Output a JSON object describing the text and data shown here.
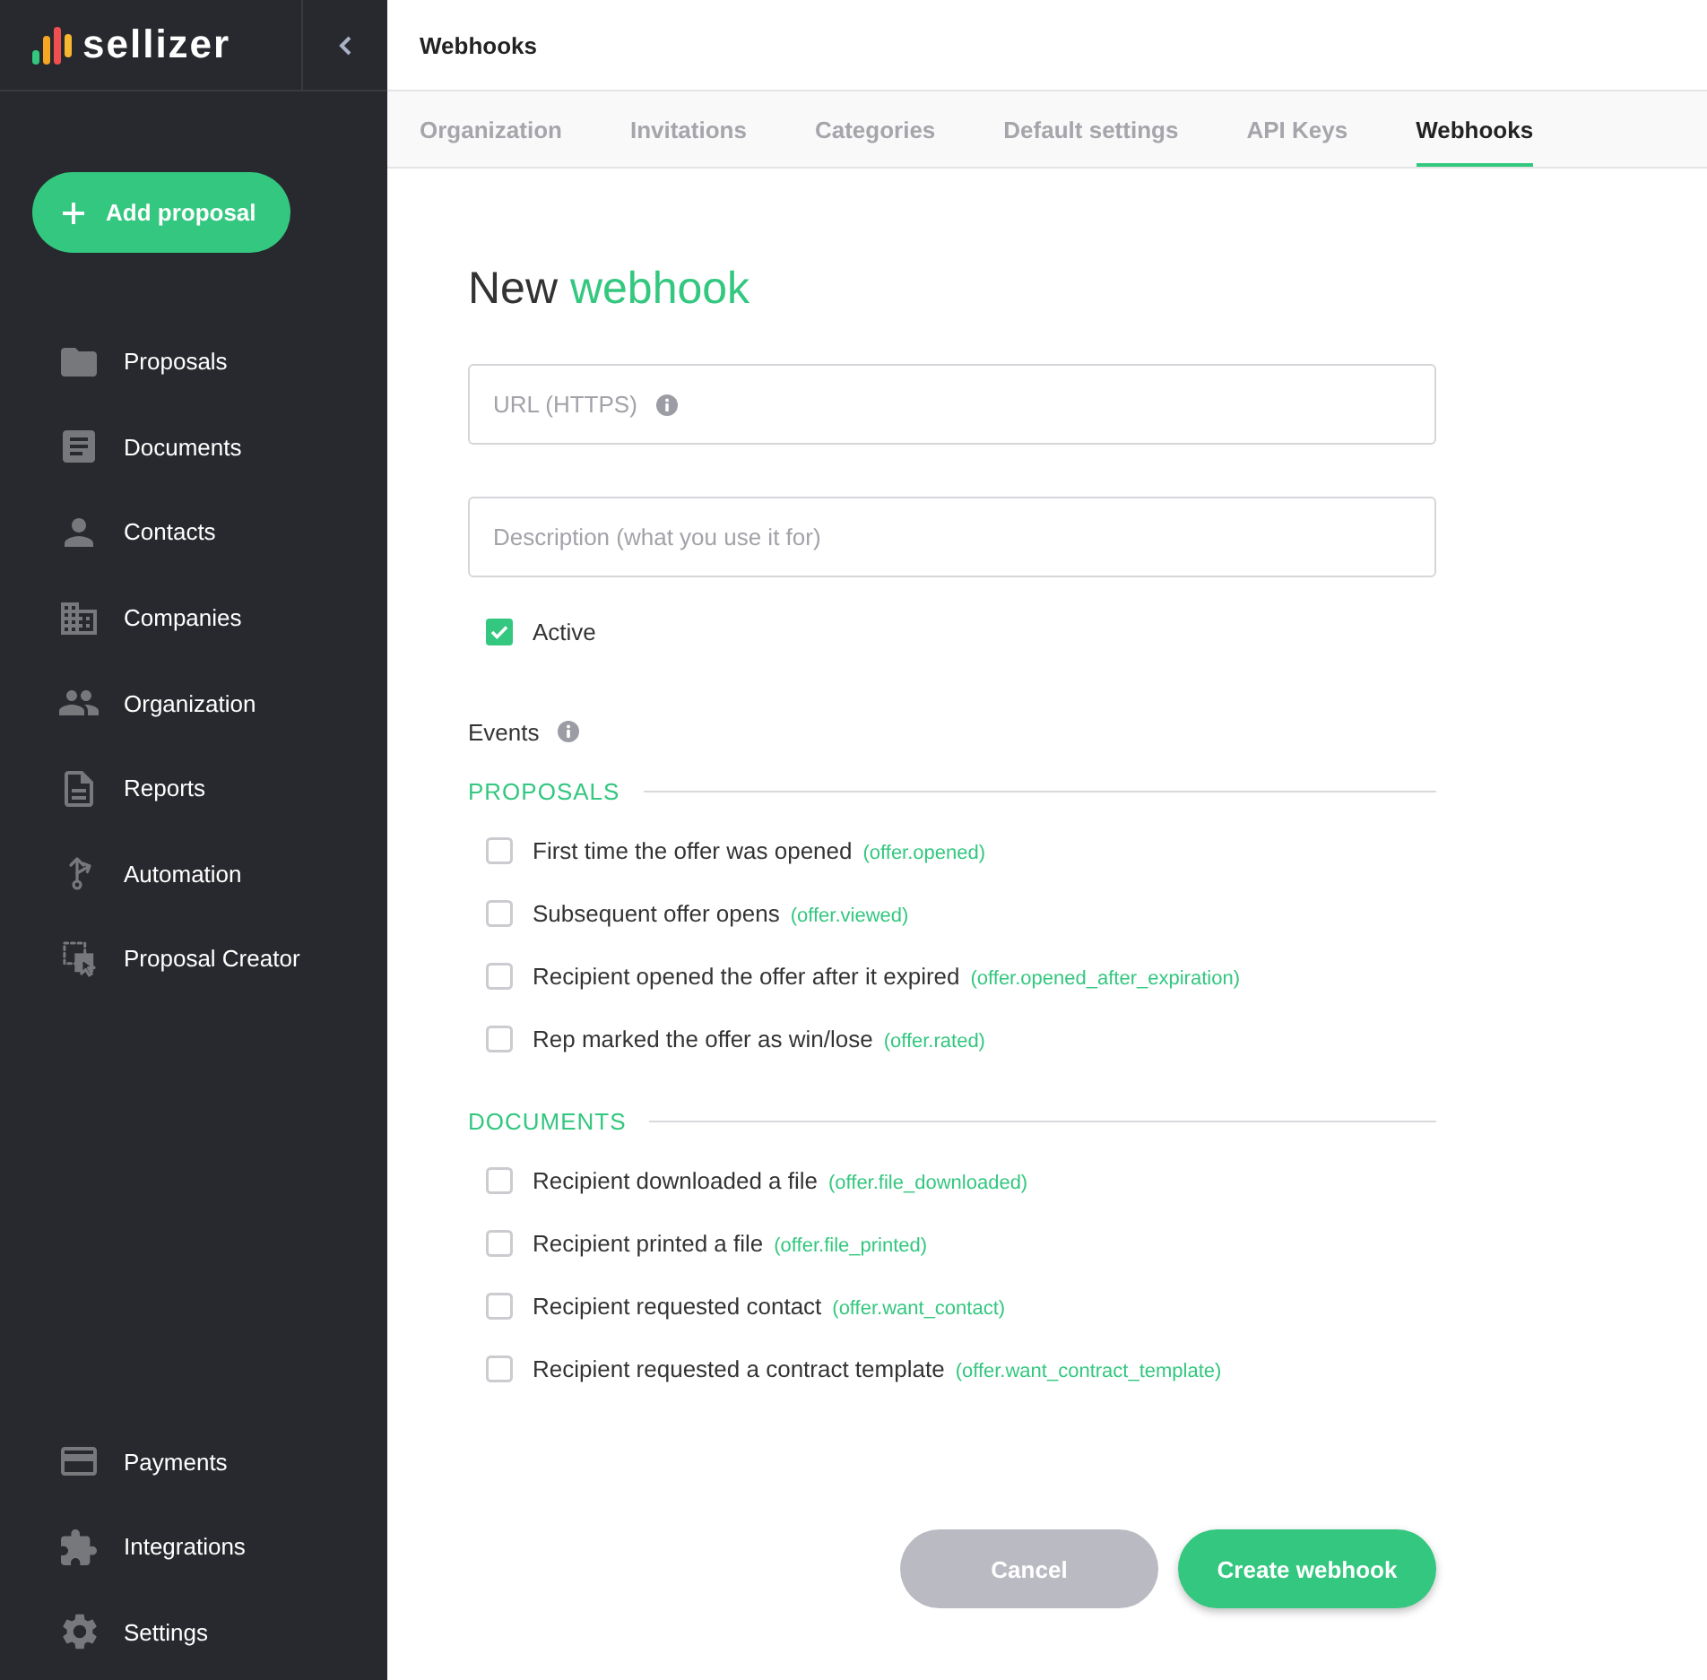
{
  "sidebar": {
    "brand": "sellizer",
    "add_button": "Add proposal",
    "items": [
      {
        "label": "Proposals",
        "selected": false
      },
      {
        "label": "Documents",
        "selected": false
      },
      {
        "label": "Contacts",
        "selected": false
      },
      {
        "label": "Companies",
        "selected": false
      },
      {
        "label": "Organization",
        "selected": false
      },
      {
        "label": "Reports",
        "selected": false
      },
      {
        "label": "Automation",
        "selected": false
      },
      {
        "label": "Proposal Creator",
        "selected": false
      }
    ],
    "bottom_items": [
      {
        "label": "Payments",
        "selected": false
      },
      {
        "label": "Integrations",
        "selected": false
      },
      {
        "label": "Settings",
        "selected": false
      }
    ]
  },
  "header": {
    "title": "Webhooks"
  },
  "tabs": [
    {
      "label": "Organization",
      "selected": false
    },
    {
      "label": "Invitations",
      "selected": false
    },
    {
      "label": "Categories",
      "selected": false
    },
    {
      "label": "Default settings",
      "selected": false
    },
    {
      "label": "API Keys",
      "selected": false
    },
    {
      "label": "Webhooks",
      "selected": true
    }
  ],
  "form": {
    "title": {
      "text": "New",
      "accent": "webhook"
    },
    "url": {
      "placeholder": "URL (HTTPS)"
    },
    "description": {
      "placeholder": "Description (what you use it for)"
    },
    "active": {
      "label": "Active",
      "checked": true
    },
    "events_label": "Events",
    "groups": [
      {
        "title": "PROPOSALS",
        "events": [
          {
            "label": "First time the offer was opened",
            "code": "(offer.opened)",
            "checked": false
          },
          {
            "label": "Subsequent offer opens",
            "code": "(offer.viewed)",
            "checked": false
          },
          {
            "label": "Recipient opened the offer after it expired",
            "code": "(offer.opened_after_expiration)",
            "checked": false
          },
          {
            "label": "Rep marked the offer as win/lose",
            "code": "(offer.rated)",
            "checked": false
          }
        ]
      },
      {
        "title": "DOCUMENTS",
        "events": [
          {
            "label": "Recipient downloaded a file",
            "code": "(offer.file_downloaded)",
            "checked": false
          },
          {
            "label": "Recipient printed a file",
            "code": "(offer.file_printed)",
            "checked": false
          },
          {
            "label": "Recipient requested contact",
            "code": "(offer.want_contact)",
            "checked": false
          },
          {
            "label": "Recipient requested a contract template",
            "code": "(offer.want_contract_template)",
            "checked": false
          }
        ]
      }
    ]
  },
  "buttons": [
    {
      "label": "Cancel",
      "kind": "secondary"
    },
    {
      "label": "Create webhook",
      "kind": "primary"
    }
  ]
}
